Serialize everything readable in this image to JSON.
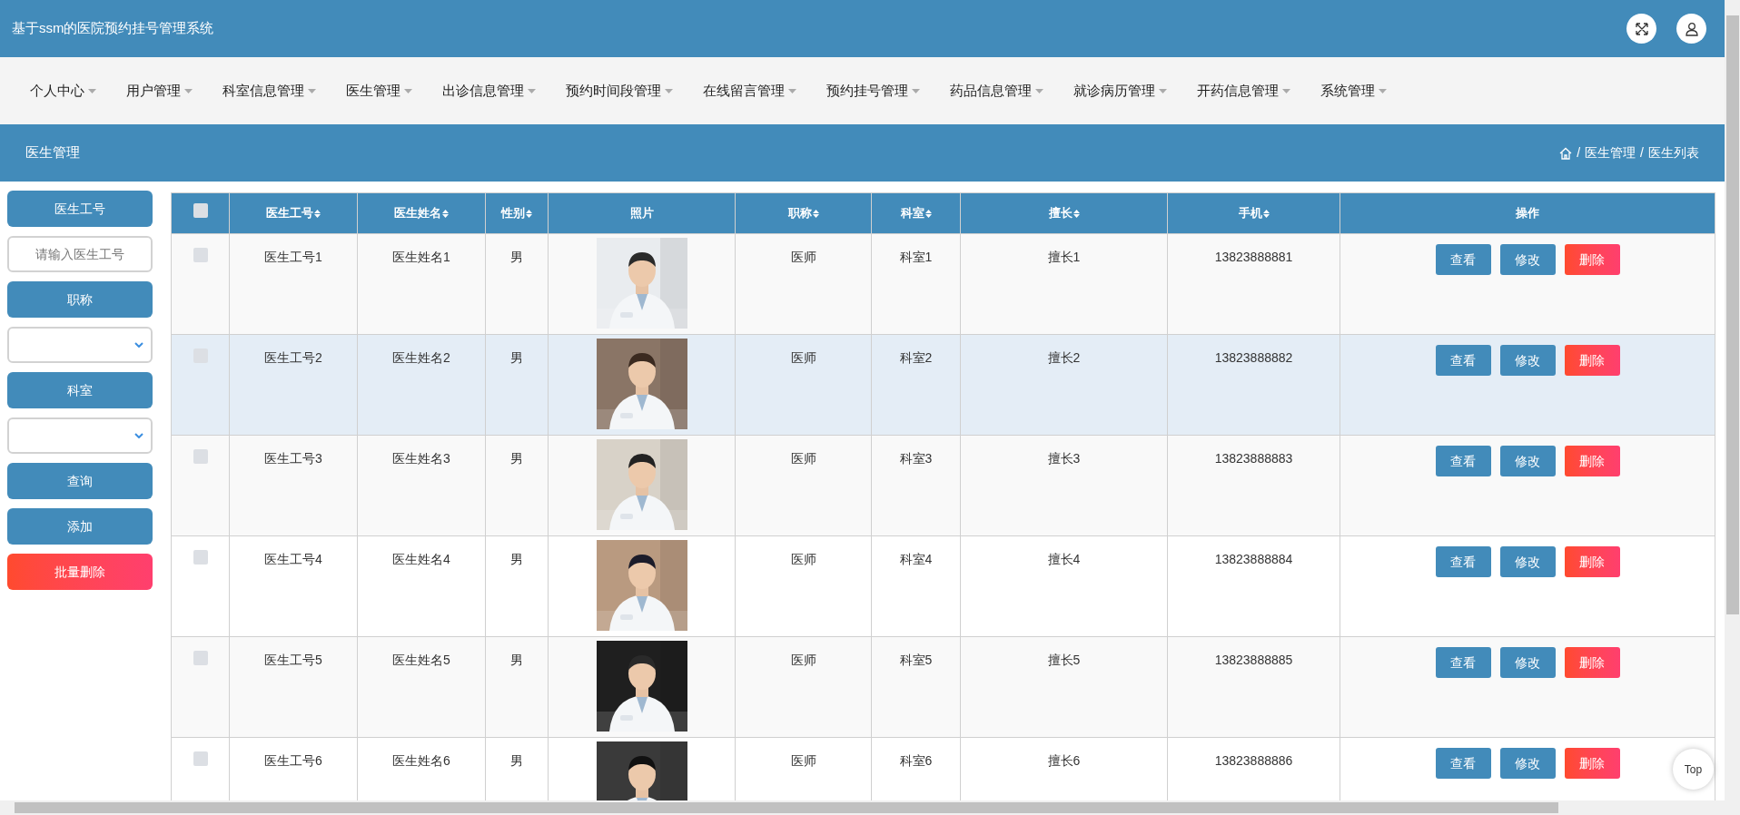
{
  "header": {
    "title": "基于ssm的医院预约挂号管理系统"
  },
  "nav": [
    {
      "label": "个人中心"
    },
    {
      "label": "用户管理"
    },
    {
      "label": "科室信息管理"
    },
    {
      "label": "医生管理"
    },
    {
      "label": "出诊信息管理"
    },
    {
      "label": "预约时间段管理"
    },
    {
      "label": "在线留言管理"
    },
    {
      "label": "预约挂号管理"
    },
    {
      "label": "药品信息管理"
    },
    {
      "label": "就诊病历管理"
    },
    {
      "label": "开药信息管理"
    },
    {
      "label": "系统管理"
    }
  ],
  "page_bar": {
    "title": "医生管理",
    "breadcrumb": [
      {
        "separator": "/",
        "label": "医生管理"
      },
      {
        "separator": "/",
        "label": "医生列表"
      }
    ]
  },
  "sidebar": [
    {
      "kind": "label",
      "text": "医生工号"
    },
    {
      "kind": "input",
      "placeholder": "请输入医生工号"
    },
    {
      "kind": "label",
      "text": "职称"
    },
    {
      "kind": "select"
    },
    {
      "kind": "label",
      "text": "科室"
    },
    {
      "kind": "select"
    },
    {
      "kind": "button",
      "text": "查询"
    },
    {
      "kind": "button",
      "text": "添加"
    },
    {
      "kind": "danger",
      "text": "批量删除"
    }
  ],
  "table": {
    "select_all": {
      "checked": false
    },
    "columns": [
      {
        "label": "医生工号",
        "sortable": true
      },
      {
        "label": "医生姓名",
        "sortable": true
      },
      {
        "label": "性别",
        "sortable": true
      },
      {
        "label": "照片",
        "sortable": false
      },
      {
        "label": "职称",
        "sortable": true
      },
      {
        "label": "科室",
        "sortable": true
      },
      {
        "label": "擅长",
        "sortable": true
      },
      {
        "label": "手机",
        "sortable": true
      },
      {
        "label": "操作",
        "sortable": false
      }
    ],
    "rows": [
      {
        "checked": false,
        "hovered": false,
        "cells": [
          "医生工号1",
          "医生姓名1",
          "男",
          {
            "kind": "picture"
          },
          "医师",
          "科室1",
          "擅长1",
          "13823888881",
          {
            "kind": "actions",
            "buttons": [
              {
                "label": "查看",
                "kind": "primary"
              },
              {
                "label": "修改",
                "kind": "primary"
              },
              {
                "label": "删除",
                "kind": "danger"
              }
            ]
          }
        ]
      },
      {
        "checked": false,
        "hovered": true,
        "cells": [
          "医生工号2",
          "医生姓名2",
          "男",
          {
            "kind": "picture"
          },
          "医师",
          "科室2",
          "擅长2",
          "13823888882",
          {
            "kind": "actions",
            "buttons": [
              {
                "label": "查看",
                "kind": "primary"
              },
              {
                "label": "修改",
                "kind": "primary"
              },
              {
                "label": "删除",
                "kind": "danger"
              }
            ]
          }
        ]
      },
      {
        "checked": false,
        "hovered": false,
        "cells": [
          "医生工号3",
          "医生姓名3",
          "男",
          {
            "kind": "picture"
          },
          "医师",
          "科室3",
          "擅长3",
          "13823888883",
          {
            "kind": "actions",
            "buttons": [
              {
                "label": "查看",
                "kind": "primary"
              },
              {
                "label": "修改",
                "kind": "primary"
              },
              {
                "label": "删除",
                "kind": "danger"
              }
            ]
          }
        ]
      },
      {
        "checked": false,
        "hovered": false,
        "cells": [
          "医生工号4",
          "医生姓名4",
          "男",
          {
            "kind": "picture"
          },
          "医师",
          "科室4",
          "擅长4",
          "13823888884",
          {
            "kind": "actions",
            "buttons": [
              {
                "label": "查看",
                "kind": "primary"
              },
              {
                "label": "修改",
                "kind": "primary"
              },
              {
                "label": "删除",
                "kind": "danger"
              }
            ]
          }
        ]
      },
      {
        "checked": false,
        "hovered": false,
        "cells": [
          "医生工号5",
          "医生姓名5",
          "男",
          {
            "kind": "picture"
          },
          "医师",
          "科室5",
          "擅长5",
          "13823888885",
          {
            "kind": "actions",
            "buttons": [
              {
                "label": "查看",
                "kind": "primary"
              },
              {
                "label": "修改",
                "kind": "primary"
              },
              {
                "label": "删除",
                "kind": "danger"
              }
            ]
          }
        ]
      },
      {
        "checked": false,
        "hovered": false,
        "cells": [
          "医生工号6",
          "医生姓名6",
          "男",
          {
            "kind": "picture"
          },
          "医师",
          "科室6",
          "擅长6",
          "13823888886",
          {
            "kind": "actions",
            "buttons": [
              {
                "label": "查看",
                "kind": "primary"
              },
              {
                "label": "修改",
                "kind": "primary"
              },
              {
                "label": "删除",
                "kind": "danger"
              }
            ]
          }
        ]
      }
    ]
  },
  "back_to_top": "Top"
}
